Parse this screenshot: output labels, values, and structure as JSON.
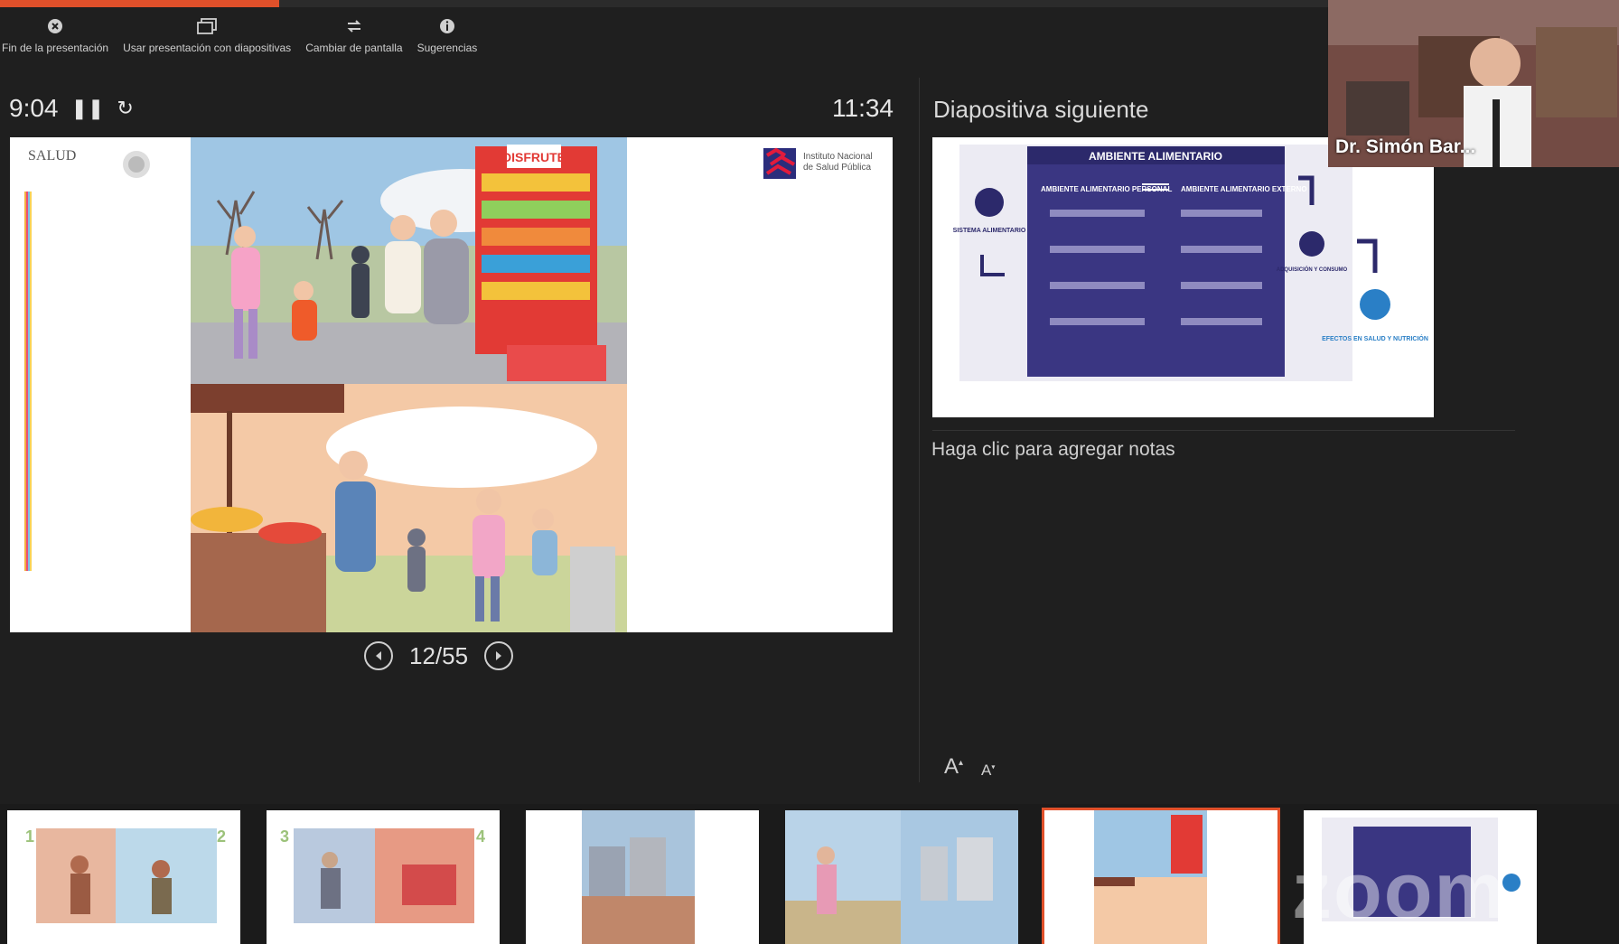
{
  "progress": {
    "fraction": 0.21
  },
  "toolbar": {
    "end": "Fin de la presentación",
    "use": "Usar presentación con diapositivas",
    "switch": "Cambiar de pantalla",
    "tips": "Sugerencias"
  },
  "timer": {
    "elapsed": "9:04",
    "clock": "11:34"
  },
  "slide": {
    "logo_left": "SALUD",
    "logo_right_line1": "Instituto Nacional",
    "logo_right_line2": "de Salud Pública",
    "store_sign": "DISFRUTE",
    "counter": "12/55"
  },
  "next": {
    "title": "Diapositiva siguiente",
    "slide_title": "AMBIENTE ALIMENTARIO",
    "left_col": "AMBIENTE ALIMENTARIO PERSONAL",
    "right_col": "AMBIENTE ALIMENTARIO EXTERNO",
    "sistema": "SISTEMA ALIMENTARIO",
    "adquisicion": "ADQUISICIÓN Y CONSUMO",
    "efectos": "EFECTOS EN SALUD Y NUTRICIÓN"
  },
  "notes": {
    "placeholder": "Haga clic para agregar notas"
  },
  "video": {
    "name": "Dr. Simón Bar..."
  },
  "thumbnails": {
    "selected_index": 4
  },
  "watermark": "zoom",
  "colors": {
    "accent": "#e0502a",
    "background": "#1f1f1f"
  }
}
